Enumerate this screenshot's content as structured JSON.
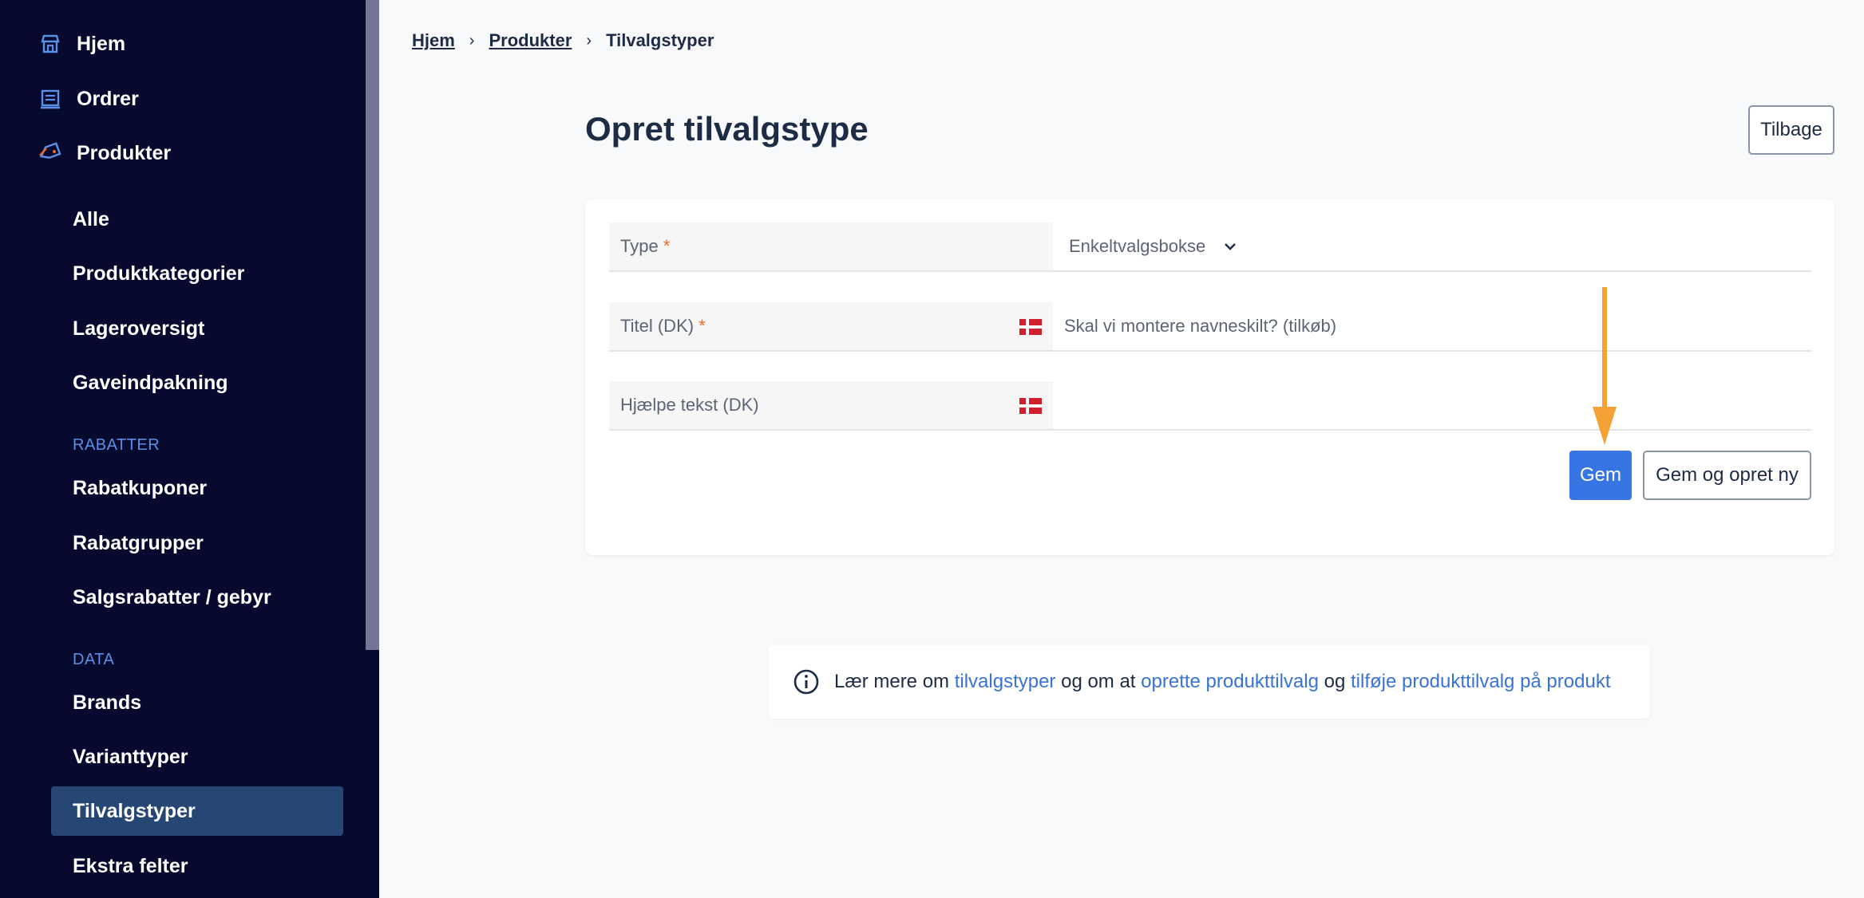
{
  "sidebar": {
    "top_items": [
      {
        "label": "Hjem",
        "icon": "shop-icon"
      },
      {
        "label": "Ordrer",
        "icon": "orders-icon"
      },
      {
        "label": "Produkter",
        "icon": "tag-icon"
      }
    ],
    "product_items": [
      "Alle",
      "Produktkategorier",
      "Lageroversigt",
      "Gaveindpakning"
    ],
    "section_rabatter": "RABATTER",
    "rabatter_items": [
      "Rabatkuponer",
      "Rabatgrupper",
      "Salgsrabatter / gebyr"
    ],
    "section_data": "DATA",
    "data_items": [
      "Brands",
      "Varianttyper",
      "Tilvalgstyper",
      "Ekstra felter"
    ],
    "active_item": "Tilvalgstyper"
  },
  "breadcrumb": {
    "home": "Hjem",
    "products": "Produkter",
    "current": "Tilvalgstyper"
  },
  "page": {
    "title": "Opret tilvalgstype",
    "back_label": "Tilbage"
  },
  "form": {
    "type_label": "Type",
    "type_value": "Enkeltvalgsbokse",
    "title_label": "Titel (DK)",
    "title_value": "Skal vi montere navneskilt? (tilkøb)",
    "help_label": "Hjælpe tekst (DK)",
    "help_value": "",
    "required_mark": "*",
    "save_label": "Gem",
    "save_new_label": "Gem og opret ny"
  },
  "info": {
    "prefix": "Lær mere om ",
    "link1": "tilvalgstyper",
    "mid": " og om at ",
    "link2": "oprette produkttilvalg",
    "mid2": " og ",
    "link3": "tilføje produkttilvalg på produkt"
  },
  "colors": {
    "sidebar_bg": "#050a2e",
    "active_bg": "#264674",
    "accent_blue": "#3776e2",
    "annotation_arrow": "#f4a236",
    "required": "#ee6b2e"
  }
}
